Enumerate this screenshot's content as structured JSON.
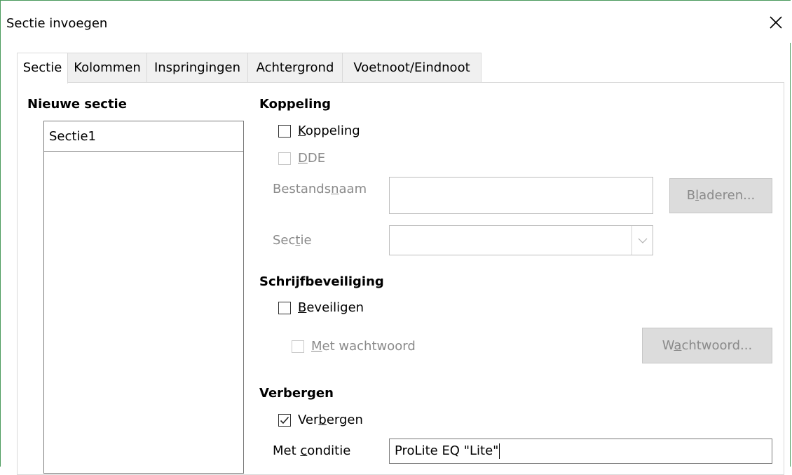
{
  "window": {
    "title": "Sectie invoegen",
    "close_icon": "close-icon"
  },
  "tabs": [
    {
      "label": "Sectie",
      "active": true
    },
    {
      "label": "Kolommen",
      "active": false
    },
    {
      "label": "Inspringingen",
      "active": false
    },
    {
      "label": "Achtergrond",
      "active": false
    },
    {
      "label": "Voetnoot/Eindnoot",
      "active": false
    }
  ],
  "new_section": {
    "heading": "Nieuwe sectie",
    "name_value": "Sectie1"
  },
  "link": {
    "heading": "Koppeling",
    "checkbox_label_pre": "",
    "checkbox_label_u": "K",
    "checkbox_label_post": "oppeling",
    "checkbox_checked": false,
    "dde_label_u": "D",
    "dde_label_post": "DE",
    "dde_checked": false,
    "filename_label_pre": "Bestands",
    "filename_label_u": "n",
    "filename_label_post": "aam",
    "filename_value": "",
    "browse_pre": "B",
    "browse_u": "l",
    "browse_post": "aderen...",
    "section_label_pre": "Sec",
    "section_label_u": "t",
    "section_label_post": "ie",
    "section_value": ""
  },
  "write_protection": {
    "heading": "Schrijfbeveiliging",
    "protect_label_u": "B",
    "protect_label_post": "eveiligen",
    "protect_checked": false,
    "password_label_u": "M",
    "password_label_post": "et wachtwoord",
    "password_checked": false,
    "password_button_pre": "W",
    "password_button_u": "a",
    "password_button_post": "chtwoord..."
  },
  "hide": {
    "heading": "Verbergen",
    "hide_label_pre": "Ver",
    "hide_label_u": "b",
    "hide_label_post": "ergen",
    "hide_checked": true,
    "condition_label_pre": "Met ",
    "condition_label_u": "c",
    "condition_label_post": "onditie",
    "condition_value": "ProLite EQ \"Lite\""
  },
  "colors": {
    "window_border": "#4a9a5c",
    "disabled_text": "#8a8a8a",
    "button_bg": "#dcdcdc"
  }
}
